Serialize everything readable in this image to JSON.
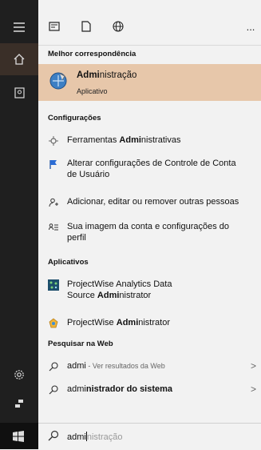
{
  "rail": {
    "icons": [
      "hamburger-icon",
      "home-icon",
      "notebook-icon",
      "gear-icon",
      "feedback-icon",
      "windows-start-icon"
    ]
  },
  "topbar": {
    "icons": [
      "apps-icon",
      "document-icon",
      "web-icon"
    ],
    "more_label": "..."
  },
  "sections": {
    "best_match": "Melhor correspondência",
    "settings": "Configurações",
    "apps": "Aplicativos",
    "web": "Pesquisar na Web"
  },
  "best_match": {
    "title_bold": "Admi",
    "title_rest": "nistração",
    "subtitle": "Aplicativo"
  },
  "settings_items": [
    {
      "pre": "Ferramentas ",
      "bold": "Admi",
      "post": "nistrativas"
    },
    {
      "line1": "Alterar configurações de Controle de Conta",
      "line2": "de Usuário"
    },
    {
      "line1": "Adicionar, editar ou remover outras pessoas"
    },
    {
      "line1": "Sua imagem da conta e configurações do",
      "line2": "perfil"
    }
  ],
  "apps_items": [
    {
      "line1": "ProjectWise Analytics Data",
      "line2_pre": "Source ",
      "line2_bold": "Admi",
      "line2_post": "nistrator"
    },
    {
      "pre": "ProjectWise ",
      "bold": "Admi",
      "post": "nistrator"
    }
  ],
  "web_items": [
    {
      "main": "admi",
      "muted": " - Ver resultados da Web"
    },
    {
      "pre": "admi",
      "bold": "nistrador do sistema"
    }
  ],
  "search": {
    "typed": "admi",
    "suggestion_rest": "nistração"
  },
  "colors": {
    "rail": "#1f1f1f",
    "highlight": "#e7c7aa",
    "panel": "#f2f2f2"
  }
}
